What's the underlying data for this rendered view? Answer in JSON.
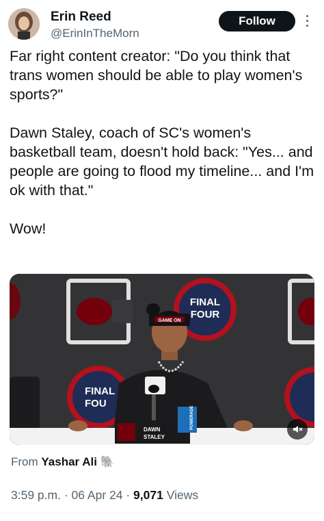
{
  "author": {
    "name": "Erin Reed",
    "handle": "@ErinInTheMorn"
  },
  "follow_label": "Follow",
  "tweet": {
    "text": "Far right content creator: \"Do you think that trans women should be able to play women's sports?\"\n\nDawn Staley, coach of SC's women's basketball team, doesn't hold back: \"Yes... and people are going to flood my timeline... and I'm ok with that.\"\n\nWow!"
  },
  "media": {
    "backdrop_logo_text": "FINAL FOUR",
    "backdrop_logo_text_partial": "FINAL FOU",
    "cap_text": "GAME ON",
    "nameplate_line1": "DAWN",
    "nameplate_line2": "STALEY",
    "cup_text": "POWERADE",
    "mute_icon": "speaker-muted-icon"
  },
  "attribution": {
    "prefix": "From",
    "source": "Yashar Ali",
    "emoji": "🐘"
  },
  "meta": {
    "time": "3:59 p.m.",
    "separator": "·",
    "date": "06 Apr 24",
    "views_count": "9,071",
    "views_label": "Views"
  },
  "colors": {
    "garnet": "#73000a",
    "text_primary": "#0f1419",
    "text_secondary": "#536471",
    "follow_bg": "#0f1419"
  }
}
